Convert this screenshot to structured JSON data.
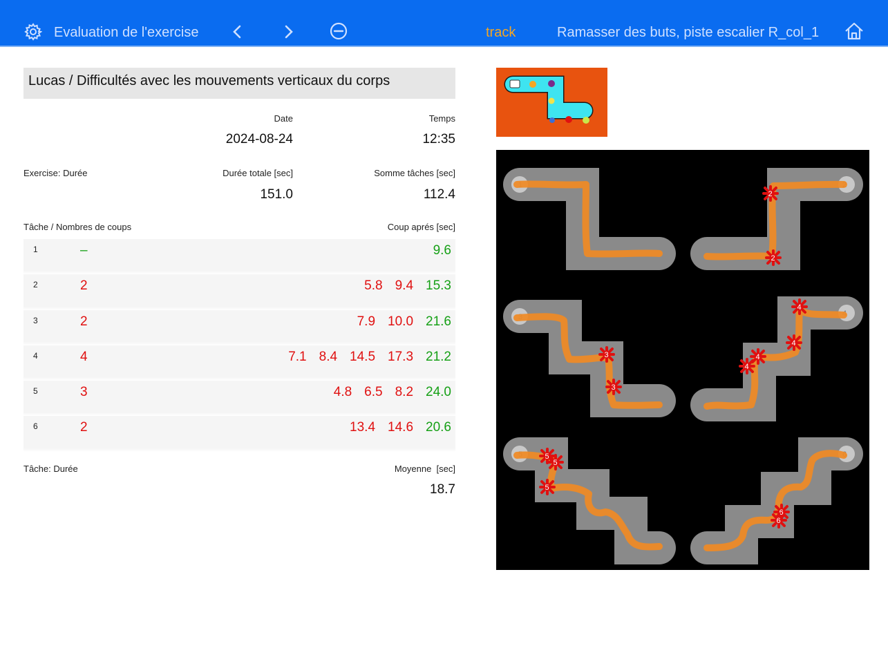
{
  "header": {
    "title": "Evaluation de l'exercise",
    "mode": "track",
    "exercise_name": "Ramasser des buts, piste escalier R_col_1",
    "icons": [
      "gear-icon",
      "chevron-left-icon",
      "chevron-right-icon",
      "minus-circle-icon",
      "home-icon"
    ]
  },
  "patient": {
    "label": "Lucas / Difficultés avec les mouvements verticaux du corps"
  },
  "session": {
    "date_label": "Date",
    "date": "2024-08-24",
    "time_label": "Temps",
    "time": "12:35"
  },
  "exercise": {
    "label": "Exercise: Durée",
    "total_label": "Durée totale [sec]",
    "total": "151.0",
    "sum_label": "Somme tâches [sec]",
    "sum": "112.4"
  },
  "tasks": {
    "header_left": "Tâche / Nombres de coups",
    "header_right": "Coup aprés [sec]",
    "rows": [
      {
        "num": "1",
        "count": "–",
        "hits": [],
        "final": "9.6"
      },
      {
        "num": "2",
        "count": "2",
        "hits": [
          "5.8",
          "9.4"
        ],
        "final": "15.3"
      },
      {
        "num": "3",
        "count": "2",
        "hits": [
          "7.9",
          "10.0"
        ],
        "final": "21.6"
      },
      {
        "num": "4",
        "count": "4",
        "hits": [
          "7.1",
          "8.4",
          "14.5",
          "17.3"
        ],
        "final": "21.2"
      },
      {
        "num": "5",
        "count": "3",
        "hits": [
          "4.8",
          "6.5",
          "8.2"
        ],
        "final": "24.0"
      },
      {
        "num": "6",
        "count": "2",
        "hits": [
          "13.4",
          "14.6"
        ],
        "final": "20.6"
      }
    ]
  },
  "summary": {
    "label": "Tâche: Durée",
    "mean_label": "Moyenne  [sec]",
    "mean": "18.7"
  },
  "colors": {
    "header_bg": "#0a6cf0",
    "accent": "#f5a623",
    "hit_red": "#e01010",
    "final_green": "#16a016",
    "track_orange": "#f08a24",
    "thumb_bg": "#e8530f",
    "thumb_track": "#3ee4f0"
  },
  "tracks": {
    "panels": [
      {
        "task": "1",
        "start_label": "1",
        "markers": 0
      },
      {
        "task": "2",
        "start_label": "2",
        "markers": 2
      },
      {
        "task": "3",
        "start_label": "3",
        "markers": 2
      },
      {
        "task": "4",
        "start_label": "4",
        "markers": 4
      },
      {
        "task": "5",
        "start_label": "5",
        "markers": 3
      },
      {
        "task": "6",
        "start_label": "6",
        "markers": 2
      }
    ]
  }
}
